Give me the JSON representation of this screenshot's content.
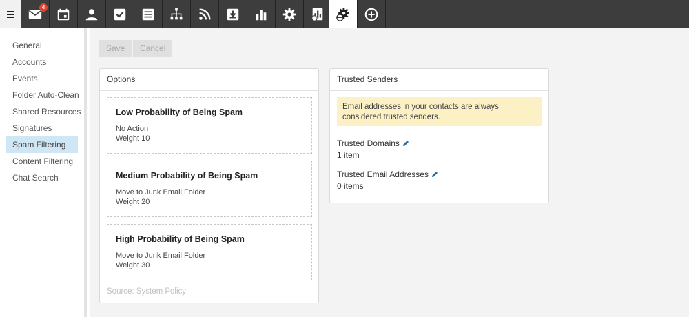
{
  "topbar": {
    "menu_icon": "hamburger-menu-icon",
    "mail_badge": "4",
    "icons": [
      "mail-icon",
      "calendar-icon",
      "contacts-icon",
      "tasks-icon",
      "notes-icon",
      "org-chart-icon",
      "rss-icon",
      "download-icon",
      "reports-icon",
      "settings-icon",
      "domain-reports-icon",
      "domain-settings-icon",
      "add-icon"
    ],
    "active_icon": "domain-settings-icon"
  },
  "sidebar": {
    "items": [
      {
        "label": "General"
      },
      {
        "label": "Accounts"
      },
      {
        "label": "Events"
      },
      {
        "label": "Folder Auto-Clean"
      },
      {
        "label": "Shared Resources"
      },
      {
        "label": "Signatures"
      },
      {
        "label": "Spam Filtering"
      },
      {
        "label": "Content Filtering"
      },
      {
        "label": "Chat Search"
      }
    ],
    "active_index": 6
  },
  "toolbar": {
    "save_label": "Save",
    "cancel_label": "Cancel"
  },
  "options": {
    "title": "Options",
    "cards": [
      {
        "title": "Low Probability of Being Spam",
        "action": "No Action",
        "weight": "Weight 10"
      },
      {
        "title": "Medium Probability of Being Spam",
        "action": "Move to Junk Email Folder",
        "weight": "Weight 20"
      },
      {
        "title": "High Probability of Being Spam",
        "action": "Move to Junk Email Folder",
        "weight": "Weight 30"
      }
    ],
    "source": "Source: System Policy"
  },
  "trusted": {
    "title": "Trusted Senders",
    "notice": "Email addresses in your contacts are always considered trusted senders.",
    "domains_label": "Trusted Domains",
    "domains_value": "1 item",
    "addresses_label": "Trusted Email Addresses",
    "addresses_value": "0 items",
    "edit_icon": "pencil-icon"
  },
  "colors": {
    "topbar": "#3d3d3d",
    "active_nav": "#cfe6f4",
    "notice_bg": "#fcf0c5",
    "badge": "#e8412c",
    "edit_icon": "#1f6fa8"
  }
}
